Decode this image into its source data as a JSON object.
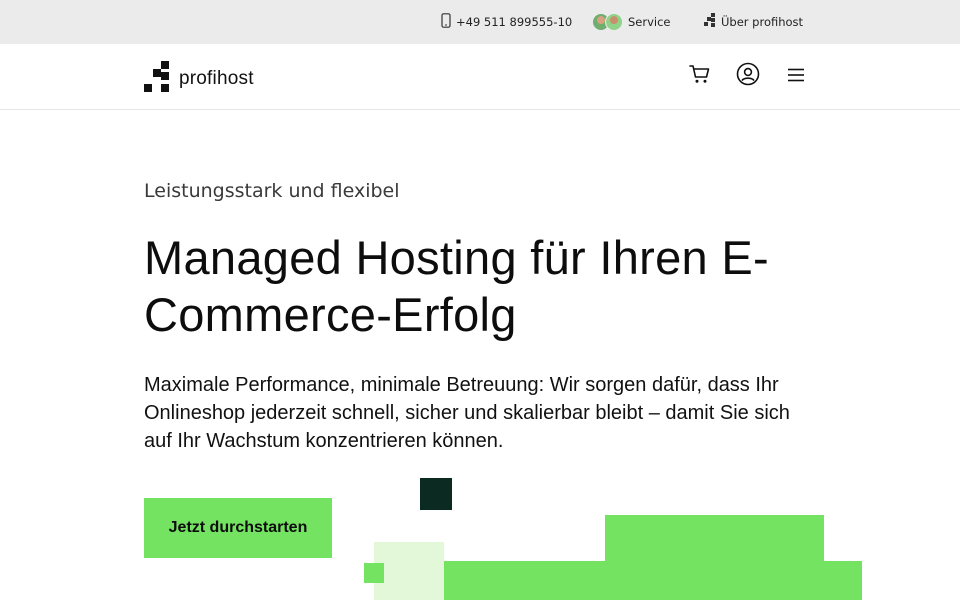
{
  "topbar": {
    "phone": "+49 511 899555-10",
    "service": "Service",
    "about": "Über profihost"
  },
  "navbar": {
    "logo_text": "profihost",
    "icons": [
      "cart-icon",
      "account-icon",
      "menu-icon"
    ]
  },
  "hero": {
    "kicker": "Leistungsstark und flexibel",
    "title": "Managed Hosting für Ihren E-Commerce-Erfolg",
    "lead": "Maximale Performance, minimale Betreuung: Wir sorgen dafür, dass Ihr Onlineshop jederzeit schnell, sicher und skalierbar bleibt – damit Sie sich auf Ihr Wachstum konzentrieren können.",
    "cta_label": "Jetzt durchstarten"
  },
  "colors": {
    "brand_green": "#74e361",
    "light_green": "#e3f8d8",
    "dark_teal": "#0b2a22",
    "topbar_bg": "#ebebeb"
  }
}
